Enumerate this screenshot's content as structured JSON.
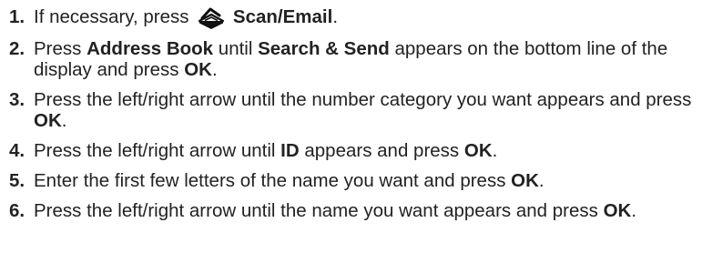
{
  "steps": [
    {
      "number": "1.",
      "parts": [
        {
          "t": "If necessary, press "
        },
        {
          "icon": "scan-icon"
        },
        {
          "t": " "
        },
        {
          "t": "Scan/Email",
          "b": true
        },
        {
          "t": "."
        }
      ]
    },
    {
      "number": "2.",
      "parts": [
        {
          "t": "Press "
        },
        {
          "t": "Address Book",
          "b": true
        },
        {
          "t": " until "
        },
        {
          "t": "Search & Send",
          "b": true
        },
        {
          "t": " appears on the bottom line of the display and press "
        },
        {
          "t": "OK",
          "b": true
        },
        {
          "t": "."
        }
      ]
    },
    {
      "number": "3.",
      "parts": [
        {
          "t": "Press the left/right arrow until the number category you want appears and press "
        },
        {
          "t": "OK",
          "b": true
        },
        {
          "t": "."
        }
      ]
    },
    {
      "number": "4.",
      "parts": [
        {
          "t": "Press the left/right arrow until "
        },
        {
          "t": "ID",
          "b": true
        },
        {
          "t": " appears and press "
        },
        {
          "t": "OK",
          "b": true
        },
        {
          "t": "."
        }
      ]
    },
    {
      "number": "5.",
      "parts": [
        {
          "t": "Enter the first few letters of the name you want and press "
        },
        {
          "t": "OK",
          "b": true
        },
        {
          "t": "."
        }
      ]
    },
    {
      "number": "6.",
      "parts": [
        {
          "t": "Press the left/right arrow until the name you want appears and press "
        },
        {
          "t": "OK",
          "b": true
        },
        {
          "t": "."
        }
      ]
    }
  ]
}
